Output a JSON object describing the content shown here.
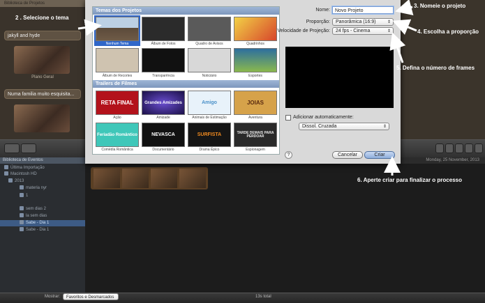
{
  "library": {
    "title": "Biblioteca de Projetos",
    "items": [
      {
        "label": "jakyll and hyde"
      },
      {
        "label": "Numa familia muito esquisita..."
      }
    ],
    "thumb_caption": "Plano Geral"
  },
  "dialog": {
    "themes_header": "Temas dos Projetos",
    "themes": [
      {
        "label": "Nenhum Tema",
        "selected": true
      },
      {
        "label": "Álbum de Fotos"
      },
      {
        "label": "Quadro de Avisos"
      },
      {
        "label": "Quadrinhos"
      },
      {
        "label": "Álbum de Recortes"
      },
      {
        "label": "Transparência"
      },
      {
        "label": "Noticiário"
      },
      {
        "label": "Esportes"
      }
    ],
    "trailers_header": "Trailers de Filmes",
    "trailers": [
      {
        "label": "Ação",
        "art": "RETA FINAL",
        "color": "#b3121b"
      },
      {
        "label": "Amizade",
        "art": "Grandes Amizades",
        "color": "#3a2a8a"
      },
      {
        "label": "Animais de Estimação",
        "art": "Amigo",
        "color": "#e8f2fa"
      },
      {
        "label": "Aventura",
        "art": "JOIAS",
        "color": "#d6a24a"
      },
      {
        "label": "Comédia Romântica",
        "art": "Feriadão Romântico",
        "color": "#3fc7b9"
      },
      {
        "label": "Documentário",
        "art": "NEVASCA",
        "color": "#111111"
      },
      {
        "label": "Drama Épico",
        "art": "SURFISTA",
        "color": "#151515"
      },
      {
        "label": "Espionagem",
        "art": "TARDE DEMAIS PARA PERDOAR",
        "color": "#2a2a2a"
      }
    ],
    "name_label": "Nome:",
    "name_value": "Novo Projeto",
    "proportion_label": "Proporção:",
    "proportion_value": "Panorâmica (16:9)",
    "speed_label": "Velocidade de Projeção:",
    "speed_value": "24 fps - Cinema",
    "auto_add_label": "Adicionar automaticamente:",
    "transition_value": "Dissol. Cruzada",
    "help": "?",
    "cancel": "Cancelar",
    "create": "Criar"
  },
  "events": {
    "header": "Biblioteca de Eventos",
    "items": [
      {
        "label": "Última Importação"
      },
      {
        "label": "Macintosh HD"
      },
      {
        "label": "2013"
      },
      {
        "label": "materia nyr"
      },
      {
        "label": "1"
      },
      {
        "label": "sem dias 2"
      },
      {
        "label": "la sem dias"
      },
      {
        "label": "Sabe - Dia 1",
        "selected": true
      },
      {
        "label": "Sabe - Dia 1"
      }
    ],
    "date": "Monday, 25 November, 2013"
  },
  "bottombar": {
    "show_label": "Mostrar:",
    "show_value": "Favoritos e Desmarcados",
    "total": "13s total"
  },
  "annotations": {
    "a2": "2 . Selecione o tema",
    "a3": "3. Nomeie o projeto",
    "a4": "4. Escolha a proporção",
    "a5": "5. Defina o número de frames",
    "a6": "6. Aperte criar para finalizar o processo"
  }
}
